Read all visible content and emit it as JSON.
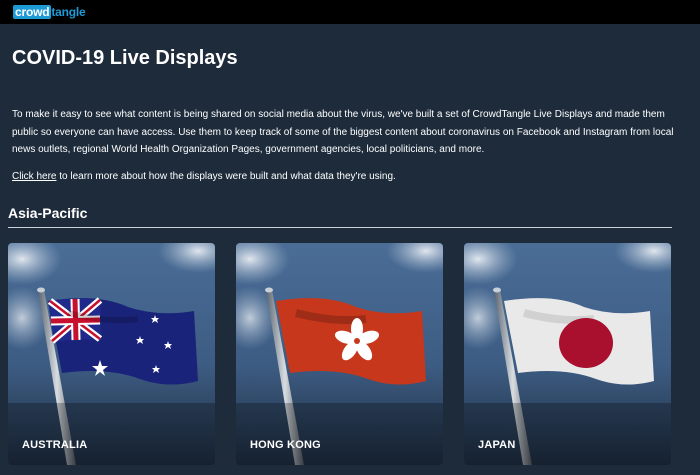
{
  "brand": {
    "logo_part1": "crowd",
    "logo_part2": "tangle"
  },
  "page": {
    "title": "COVID-19 Live Displays",
    "intro": "To make it easy to see what content is being shared on social media about the virus, we've built a set of CrowdTangle Live Displays and made them public so everyone can have access. Use them to keep track of some of the biggest content about coronavirus on Facebook and Instagram from local news outlets, regional World Health Organization Pages, government agencies, local politicians, and more.",
    "learn_more_link": "Click here",
    "learn_more_rest": " to learn more about how the displays were built and what data they're using."
  },
  "section": {
    "title": "Asia-Pacific",
    "cards": [
      {
        "label": "AUSTRALIA",
        "flag": "australia-flag"
      },
      {
        "label": "HONG KONG",
        "flag": "hong-kong-flag"
      },
      {
        "label": "JAPAN",
        "flag": "japan-flag"
      }
    ]
  },
  "colors": {
    "page_bg": "#1d2b3b",
    "topbar_bg": "#000000",
    "brand_blue": "#1e9bd7",
    "rule": "#c9d1da"
  }
}
